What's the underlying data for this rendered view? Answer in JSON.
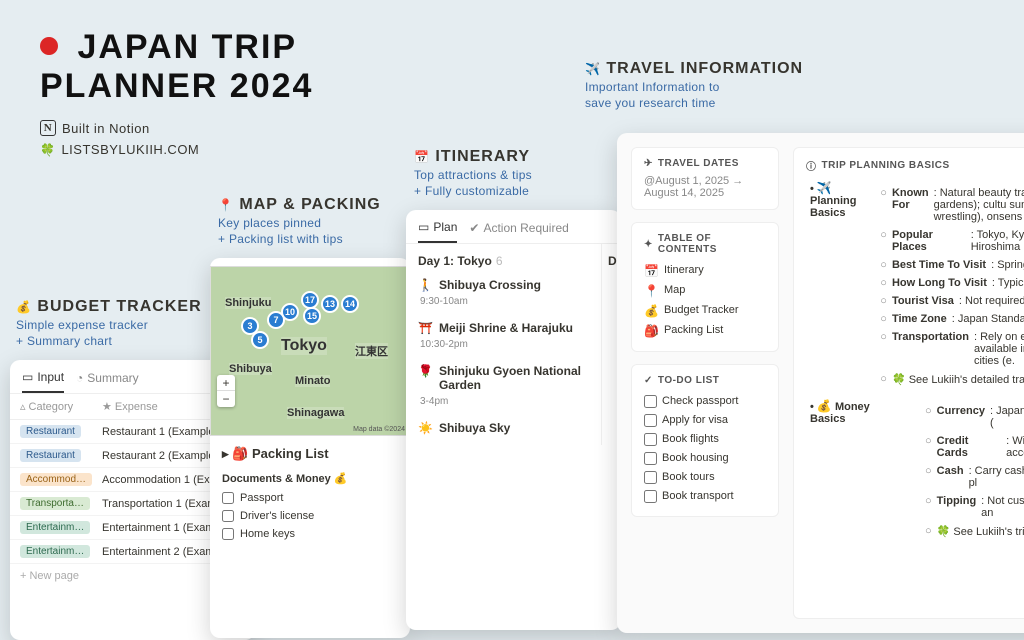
{
  "header": {
    "title_line1": "JAPAN TRIP",
    "title_line2": "PLANNER 2024",
    "built_in": "Built in Notion",
    "domain": "LISTSBYLUKIIH.COM"
  },
  "budget": {
    "label_icon": "💰",
    "label": "BUDGET TRACKER",
    "sub1": "Simple expense tracker",
    "sub2": "+ Summary chart",
    "tabs": {
      "input": "Input",
      "summary": "Summary"
    },
    "columns": {
      "category": "Category",
      "expense": "Expense"
    },
    "rows": [
      {
        "tag_class": "tag-rest",
        "tag": "Restaurant",
        "expense": "Restaurant 1 (Example)"
      },
      {
        "tag_class": "tag-rest",
        "tag": "Restaurant",
        "expense": "Restaurant 2 (Example)"
      },
      {
        "tag_class": "tag-accom",
        "tag": "Accommod…",
        "expense": "Accommodation 1 (Exam"
      },
      {
        "tag_class": "tag-trans",
        "tag": "Transporta…",
        "expense": "Transportation 1 (Examp"
      },
      {
        "tag_class": "tag-ent",
        "tag": "Entertainm…",
        "expense": "Entertainment 1 (Exampl"
      },
      {
        "tag_class": "tag-ent",
        "tag": "Entertainm…",
        "expense": "Entertainment 2 (Exampl"
      }
    ],
    "new_page": "+ New page"
  },
  "map": {
    "label_icon": "📍",
    "label": "MAP & PACKING",
    "sub1": "Key places pinned",
    "sub2": "+ Packing list with tips",
    "city": "Tokyo",
    "areas": [
      "Shinjuku",
      "Shibuya",
      "Minato",
      "Shinagawa",
      "江東区"
    ],
    "pins": [
      "3",
      "5",
      "7",
      "10",
      "13",
      "14",
      "15",
      "17"
    ],
    "attrib": "Map data ©2024",
    "packing_title": "🎒 Packing List",
    "packing_group": "Documents & Money 💰",
    "packing_items": [
      "Passport",
      "Driver's license",
      "Home keys"
    ]
  },
  "itinerary": {
    "label_icon": "📅",
    "label": "ITINERARY",
    "sub1": "Top attractions & tips",
    "sub2": "+ Fully customizable",
    "tabs": {
      "plan": "Plan",
      "action": "Action Required"
    },
    "day_title": "Day 1: Tokyo",
    "day_count": "6",
    "items": [
      {
        "icon": "🚶",
        "title": "Shibuya Crossing",
        "time": "9:30-10am"
      },
      {
        "icon": "⛩️",
        "title": "Meiji Shrine & Harajuku",
        "time": "10:30-2pm"
      },
      {
        "icon": "🌹",
        "title": "Shinjuku Gyoen National Garden",
        "time": "3-4pm"
      },
      {
        "icon": "☀️",
        "title": "Shibuya Sky",
        "time": ""
      }
    ],
    "col2_heading_prefix": "Da"
  },
  "travel": {
    "label_icon": "✈️",
    "label": "TRAVEL INFORMATION",
    "sub1": "Important Information to",
    "sub2": "save you research time",
    "dates": {
      "title": "TRAVEL DATES",
      "from": "August 1, 2025 →",
      "to": "August 14, 2025"
    },
    "toc": {
      "title": "TABLE OF CONTENTS",
      "items": [
        {
          "icon": "📅",
          "label": "Itinerary"
        },
        {
          "icon": "📍",
          "label": "Map"
        },
        {
          "icon": "💰",
          "label": "Budget Tracker"
        },
        {
          "icon": "🎒",
          "label": "Packing List"
        }
      ]
    },
    "todo": {
      "title": "TO-DO LIST",
      "items": [
        "Check passport",
        "Apply for visa",
        "Book flights",
        "Book housing",
        "Book tours",
        "Book transport"
      ]
    },
    "basics": {
      "title": "TRIP PLANNING BASICS",
      "group1_icon": "✈️",
      "group1": "Planning Basics",
      "group1_items": [
        "Known For: Natural beauty traditional gardens); cultu sumo wrestling), onsens (",
        "Popular Places: Tokyo, Ky Hiroshima",
        "Best Time To Visit: Spring",
        "How Long To Visit: Typica",
        "Tourist Visa: Not required",
        "Time Zone: Japan Standa",
        "Transportation: Rely on ef available in major cities (e.",
        "🍀 See Lukiih's detailed tra"
      ],
      "group2_icon": "💰",
      "group2": "Money Basics",
      "group2_items": [
        "Currency: Japanese Yen (",
        "Credit Cards: Widely acce",
        "Cash: Carry cash (many pl",
        "Tipping: Not customary an",
        "🍀 See Lukiih's trip cost br"
      ]
    }
  }
}
